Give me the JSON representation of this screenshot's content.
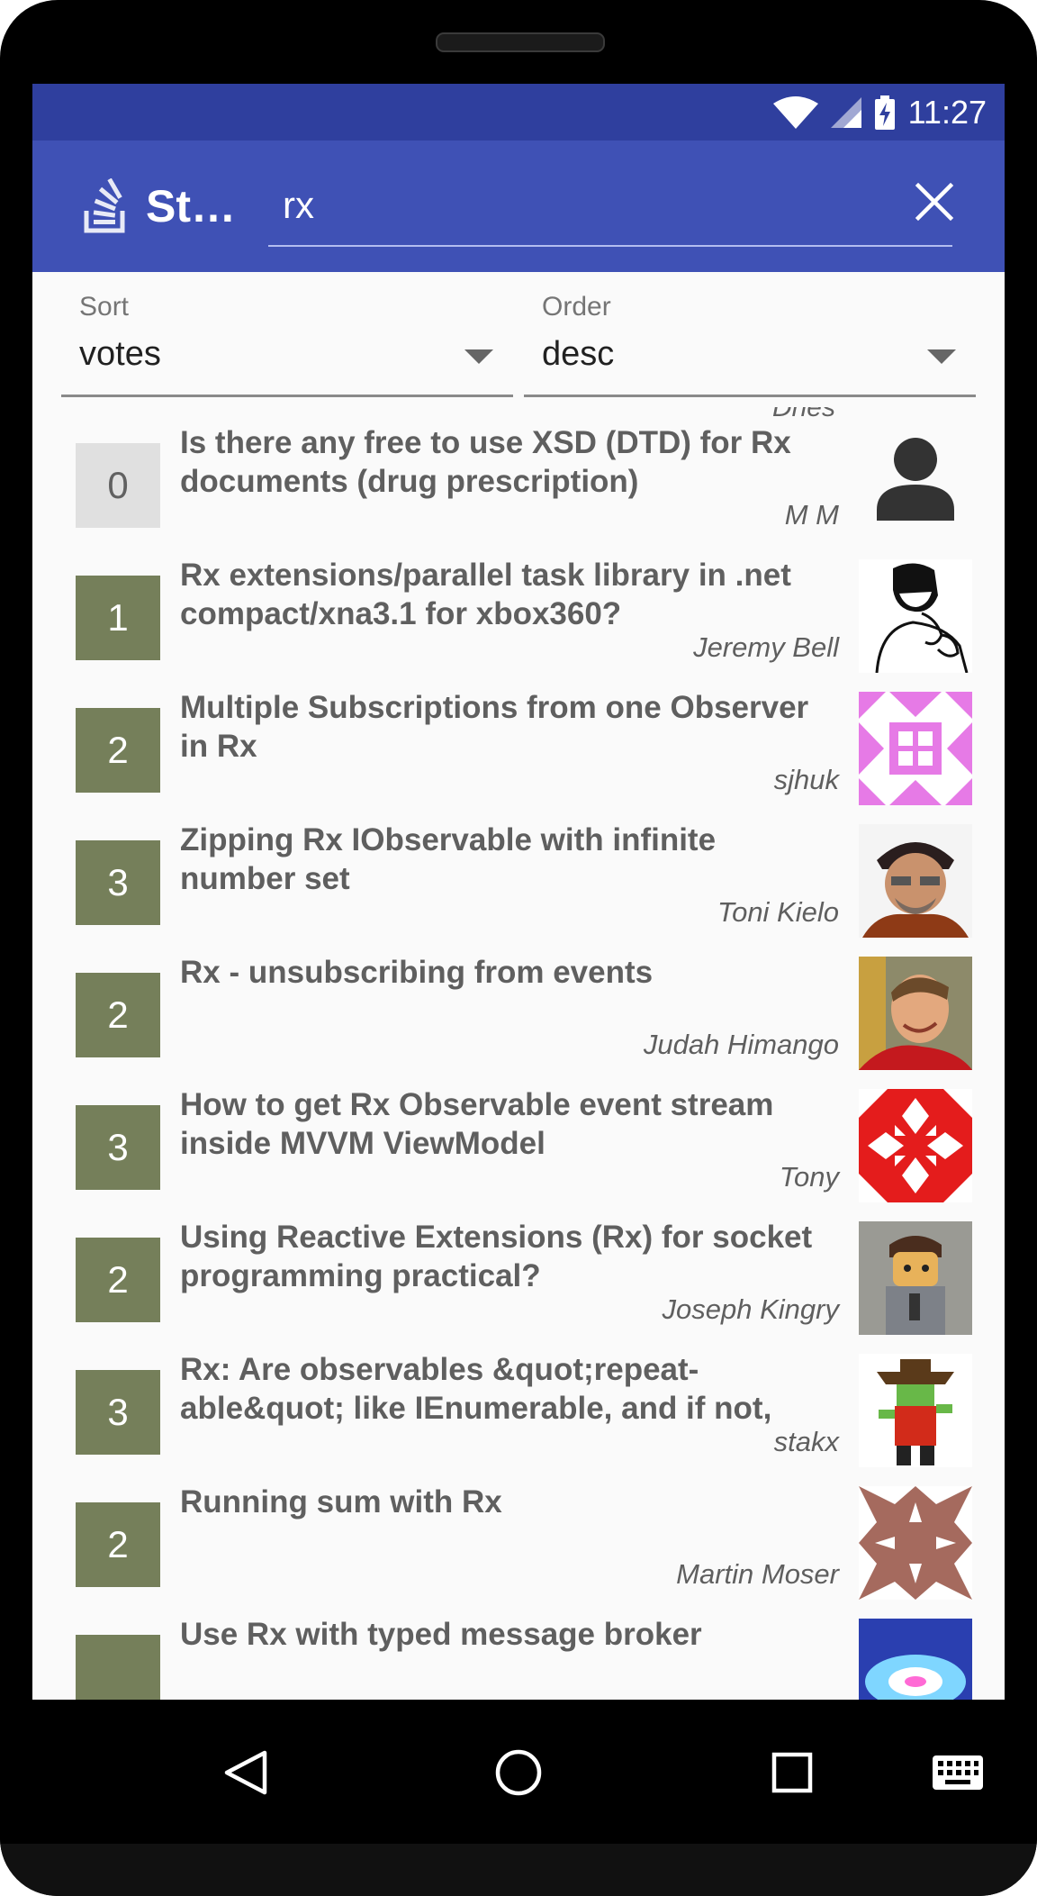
{
  "status_bar": {
    "time": "11:27"
  },
  "app_bar": {
    "title": "St…",
    "search_value": "rx",
    "search_placeholder": "",
    "colors": {
      "primary": "#3f51b5",
      "primary_dark": "#2f3f9e"
    }
  },
  "filters": {
    "sort": {
      "label": "Sort",
      "value": "votes"
    },
    "order": {
      "label": "Order",
      "value": "desc"
    }
  },
  "partial_author_above": "Dries",
  "questions": [
    {
      "score": "0",
      "title": "Is there any free to use XSD (DTD) for Rx documents (drug prescription)",
      "author": "M M",
      "avatar": "default-user-icon"
    },
    {
      "score": "1",
      "title": "Rx extensions/parallel task library in .net compact/xna3.1 for xbox360?",
      "author": "Jeremy Bell",
      "avatar": "sketch-portrait"
    },
    {
      "score": "2",
      "title": "Multiple Subscriptions from one Observer in Rx",
      "author": "sjhuk",
      "avatar": "identicon-pink"
    },
    {
      "score": "3",
      "title": "Zipping Rx IObservable with infinite number set",
      "author": "Toni Kielo",
      "avatar": "photo-bandana-man"
    },
    {
      "score": "2",
      "title": "Rx - unsubscribing from events",
      "author": "Judah Himango",
      "avatar": "photo-smiling-man"
    },
    {
      "score": "3",
      "title": "How to get Rx Observable event stream inside MVVM ViewModel",
      "author": "Tony",
      "avatar": "identicon-red"
    },
    {
      "score": "2",
      "title": "Using Reactive Extensions (Rx) for socket programming practical?",
      "author": "Joseph Kingry",
      "avatar": "lego-figure"
    },
    {
      "score": "3",
      "title": "Rx: Are observables &quot;repeat-able&quot; like IEnumerable, and if not, how",
      "author": "stakx",
      "avatar": "pixel-pirate"
    },
    {
      "score": "2",
      "title": "Running sum with Rx",
      "author": "Martin Moser",
      "avatar": "identicon-brown"
    },
    {
      "score": "",
      "title": "Use Rx with typed message broker",
      "author": "",
      "avatar": "photo-blue-swirl"
    }
  ],
  "nav_bar": {
    "icons": [
      "back-icon",
      "home-icon",
      "recents-icon",
      "keyboard-icon"
    ]
  }
}
